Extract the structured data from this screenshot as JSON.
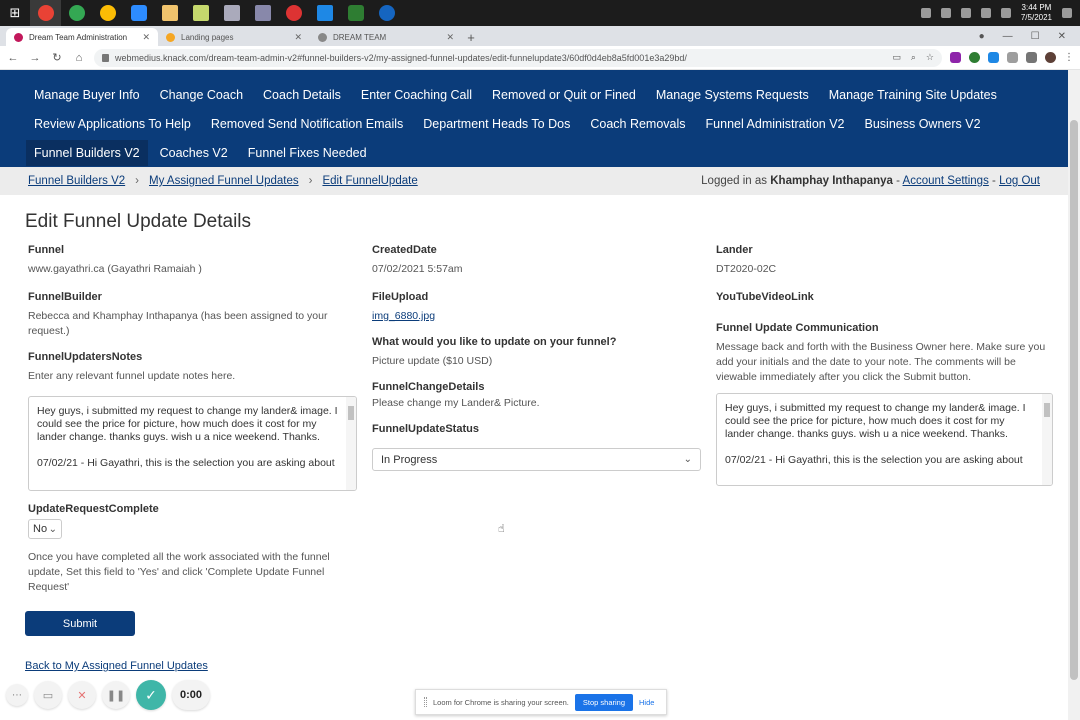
{
  "taskbar": {
    "clock_time": "3:44 PM",
    "clock_date": "7/5/2021"
  },
  "browser": {
    "tabs": [
      {
        "label": "Dream Team Administration",
        "favicon_color": "#c2185b"
      },
      {
        "label": "Landing pages",
        "favicon_color": "#f5a623"
      },
      {
        "label": "DREAM TEAM",
        "favicon_color": "#888888"
      }
    ],
    "url": "webmedius.knack.com/dream-team-admin-v2#funnel-builders-v2/my-assigned-funnel-updates/edit-funnelupdate3/60df0d4eb8a5fd001e3a29bd/"
  },
  "nav": {
    "rows": [
      [
        "Manage Buyer Info",
        "Change Coach",
        "Coach Details",
        "Enter Coaching Call",
        "Removed or Quit or Fined",
        "Manage Systems Requests",
        "Manage Training Site Updates"
      ],
      [
        "Review Applications To Help",
        "Removed Send Notification Emails",
        "Department Heads To Dos",
        "Coach Removals",
        "Funnel Administration V2",
        "Business Owners V2"
      ],
      [
        "Funnel Builders V2",
        "Coaches V2",
        "Funnel Fixes Needed"
      ]
    ],
    "active": "Funnel Builders V2"
  },
  "breadcrumb": {
    "items": [
      "Funnel Builders V2",
      "My Assigned Funnel Updates",
      "Edit FunnelUpdate"
    ],
    "logged_in_prefix": "Logged in as",
    "user": "Khamphay Inthapanya",
    "account_settings": "Account Settings",
    "log_out": "Log Out"
  },
  "page": {
    "title": "Edit Funnel Update Details"
  },
  "col1": {
    "funnel_label": "Funnel",
    "funnel_value": "www.gayathri.ca (Gayathri Ramaiah )",
    "builder_label": "FunnelBuilder",
    "builder_value": "Rebecca and Khamphay Inthapanya (has been assigned to your request.)",
    "notes_label": "FunnelUpdatersNotes",
    "notes_hint": "Enter any relevant funnel update notes here.",
    "notes_text_1": "Hey guys, i submitted my request to change my lander& image. I could see the price for picture, how much does it cost for my lander change. thanks guys. wish u a nice weekend. Thanks.",
    "notes_text_2": "07/02/21  -  Hi Gayathri, this is the selection you are asking about",
    "complete_label": "UpdateRequestComplete",
    "complete_value": "No",
    "complete_hint": "Once you have completed all the work associated with the funnel update, Set this field to 'Yes' and click 'Complete Update Funnel Request'",
    "submit_label": "Submit",
    "back_link": "Back to My Assigned Funnel Updates"
  },
  "col2": {
    "created_label": "CreatedDate",
    "created_value": "07/02/2021 5:57am",
    "file_label": "FileUpload",
    "file_value": "img_6880.jpg",
    "question_label": "What would you like to update on your funnel?",
    "question_value": "Picture update ($10 USD)",
    "change_label": "FunnelChangeDetails",
    "change_value": "Please change my Lander& Picture.",
    "status_label": "FunnelUpdateStatus",
    "status_value": "In Progress"
  },
  "col3": {
    "lander_label": "Lander",
    "lander_value": "DT2020-02C",
    "youtube_label": "YouTubeVideoLink",
    "comm_label": "Funnel Update Communication",
    "comm_hint": "Message back and forth with the Business Owner here. Make sure you add your initials and the date to your note. The comments will be viewable immediately after you click the Submit button.",
    "comm_text_1": "Hey guys, i submitted my request to change my lander& image. I could see the price for picture, how much does it cost for my lander change. thanks guys. wish u a nice weekend. Thanks.",
    "comm_text_2": "07/02/21 - Hi Gayathri, this is the selection you are asking about"
  },
  "recorder": {
    "timer": "0:00"
  },
  "share_bar": {
    "message": "Loom for Chrome is sharing your screen.",
    "stop_label": "Stop sharing",
    "hide_label": "Hide"
  }
}
